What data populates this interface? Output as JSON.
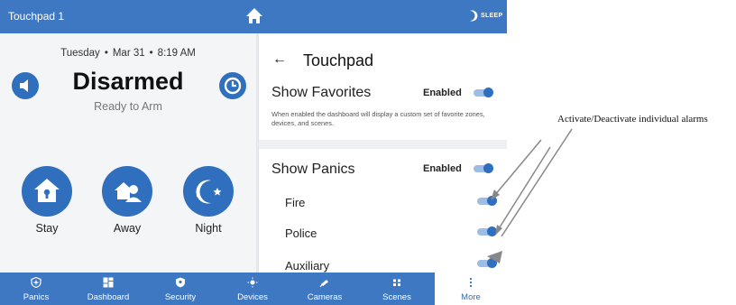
{
  "header": {
    "title": "Touchpad 1",
    "sleep_label": "SLEEP"
  },
  "left": {
    "day": "Tuesday",
    "date": "Mar 31",
    "time": "8:19 AM",
    "status": "Disarmed",
    "substatus": "Ready to Arm",
    "arm_buttons": [
      {
        "label": "Stay"
      },
      {
        "label": "Away"
      },
      {
        "label": "Night"
      }
    ]
  },
  "settings": {
    "back_symbol": "←",
    "title": "Touchpad",
    "favorites": {
      "label": "Show Favorites",
      "state": "Enabled",
      "enabled": true,
      "description": "When enabled the dashboard will display a custom set of favorite zones, devices, and scenes."
    },
    "panics": {
      "label": "Show Panics",
      "state": "Enabled",
      "enabled": true,
      "items": [
        {
          "label": "Fire",
          "enabled": true
        },
        {
          "label": "Police",
          "enabled": true
        },
        {
          "label": "Auxiliary",
          "enabled": true
        }
      ]
    }
  },
  "nav": {
    "items": [
      {
        "label": "Panics",
        "icon": "shield-plus-icon"
      },
      {
        "label": "Dashboard",
        "icon": "dashboard-grid-icon"
      },
      {
        "label": "Security",
        "icon": "security-shield-icon"
      },
      {
        "label": "Devices",
        "icon": "devices-bulb-icon"
      },
      {
        "label": "Cameras",
        "icon": "camera-icon"
      },
      {
        "label": "Scenes",
        "icon": "scenes-icon"
      },
      {
        "label": "More",
        "icon": "more-vertical-icon"
      }
    ],
    "active": "More"
  },
  "annotation": {
    "text": "Activate/Deactivate individual alarms"
  },
  "colors": {
    "brand": "#3f78c2",
    "accent": "#2f6fbd",
    "toggle_track": "#9dbde6",
    "background": "#f4f5f7"
  }
}
